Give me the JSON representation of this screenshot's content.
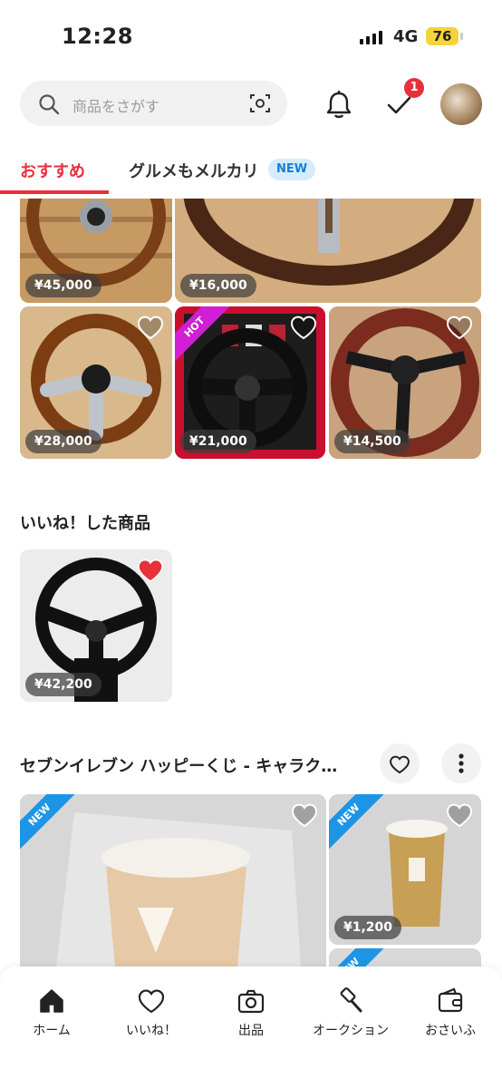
{
  "status": {
    "time": "12:28",
    "network": "4G",
    "battery": "76"
  },
  "search": {
    "placeholder": "商品をさがす"
  },
  "notifications": {
    "badge": "1"
  },
  "tabs": [
    {
      "label": "おすすめ"
    },
    {
      "label": "グルメもメルカリ",
      "badge": "NEW"
    }
  ],
  "recommended": [
    {
      "price": "¥45,000"
    },
    {
      "price": "¥16,000"
    },
    {
      "price": "¥28,000"
    },
    {
      "price": "¥21,000",
      "ribbon": "HOT"
    },
    {
      "price": "¥14,500"
    }
  ],
  "liked": {
    "title": "いいね！した商品",
    "items": [
      {
        "price": "¥42,200"
      }
    ]
  },
  "collection": {
    "title": "セブンイレブン ハッピーくじ - キャラク…",
    "items": [
      {
        "ribbon": "NEW"
      },
      {
        "ribbon": "NEW",
        "price": "¥1,200"
      },
      {
        "ribbon": "NEW"
      }
    ]
  },
  "bottom_nav": [
    {
      "label": "ホーム",
      "icon": "home-icon"
    },
    {
      "label": "いいね！",
      "icon": "heart-icon"
    },
    {
      "label": "出品",
      "icon": "camera-icon"
    },
    {
      "label": "オークション",
      "icon": "gavel-icon"
    },
    {
      "label": "おさいふ",
      "icon": "wallet-icon"
    }
  ],
  "colors": {
    "accent": "#e8303a",
    "hot": "#d11fd6",
    "new": "#1d95e6"
  }
}
